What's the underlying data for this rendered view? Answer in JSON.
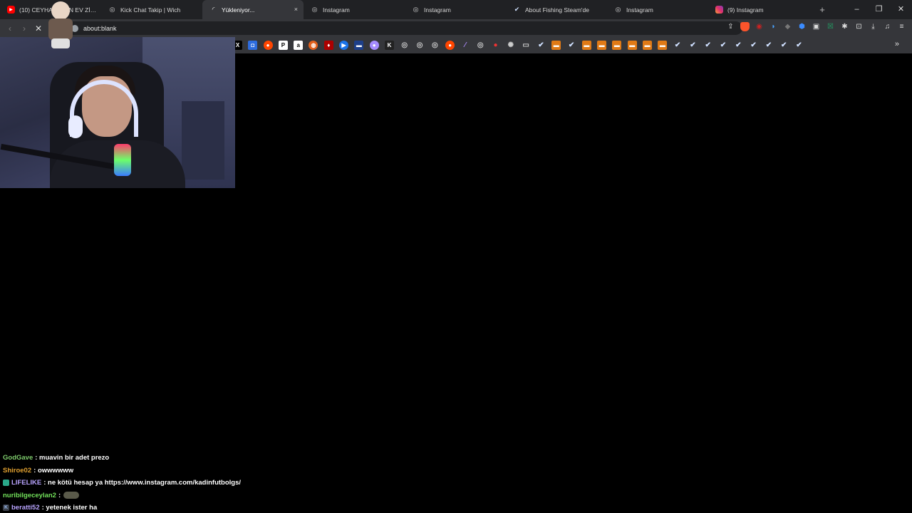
{
  "tabs": [
    {
      "title": "(10) CEYHAN ... AN EV ZİYA",
      "icon": "youtube-icon",
      "active": false
    },
    {
      "title": "Kick Chat Takip | Wich",
      "icon": "globe-icon",
      "active": false
    },
    {
      "title": "Yükleniyor...",
      "icon": "loading-icon",
      "active": true,
      "close": "×"
    },
    {
      "title": "Instagram",
      "icon": "globe-icon",
      "active": false
    },
    {
      "title": "Instagram",
      "icon": "globe-icon",
      "active": false
    },
    {
      "title": "About Fishing Steam'de",
      "icon": "steam-icon",
      "active": false
    },
    {
      "title": "Instagram",
      "icon": "globe-icon",
      "active": false
    },
    {
      "title": "(9) Instagram",
      "icon": "instagram-icon",
      "active": false
    }
  ],
  "window_controls": {
    "minimize": "–",
    "restore": "❐",
    "close": "✕"
  },
  "address": {
    "url": "about:blank"
  },
  "bookmarks": {
    "count_steam": 11,
    "count_orange": 7
  },
  "chat": [
    {
      "user": "GodGave",
      "user_color": "#7ecb6c",
      "message": ": muavin bir adet prezo",
      "badge": ""
    },
    {
      "user": "Shiroe02",
      "user_color": "#e0a030",
      "message": ": owwwwww",
      "badge": ""
    },
    {
      "user": "LIFELIKE",
      "user_color": "#b9a4ff",
      "message": ": ne kötü hesap ya https://www.instagram.com/kadinfutbolgs/",
      "badge": "badge-icon"
    },
    {
      "user": "nuribilgeceylan2",
      "user_color": "#72e05a",
      "message": ":",
      "badge": "",
      "emote": true
    },
    {
      "user": "beratti52",
      "user_color": "#b9a4ff",
      "message": ": yetenek ister ha",
      "badge": "kick-icon"
    }
  ]
}
